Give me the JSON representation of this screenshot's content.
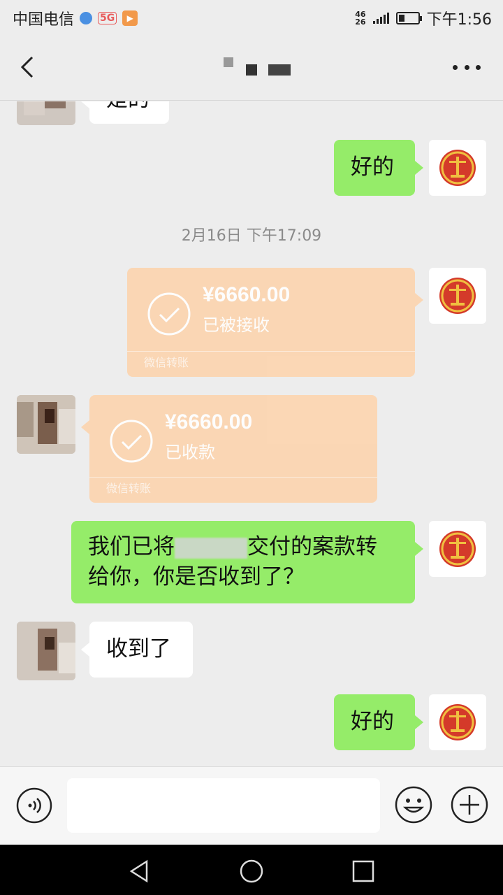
{
  "status_bar": {
    "carrier": "中国电信",
    "network_badge": "5G",
    "signal_text_top": "46",
    "signal_text_bottom": "26",
    "time": "下午1:56",
    "icons": [
      "signal-icon",
      "battery-icon",
      "video-app-icon",
      "hd-icon"
    ]
  },
  "header": {
    "back_icon": "chevron-left-icon",
    "title": "",
    "more_icon": "more-dots-icon"
  },
  "messages": {
    "m1_partial_text": "是的",
    "m2_text": "好的",
    "timestamp": "2月16日 下午17:09",
    "transfer_sent": {
      "amount": "¥6660.00",
      "status": "已被接收",
      "footer": "微信转账"
    },
    "transfer_received": {
      "amount": "¥6660.00",
      "status": "已收款",
      "footer": "微信转账"
    },
    "m5_text_before": "我们已将",
    "m5_text_after": "交付的案款转",
    "m5_text_line2": "给你，你是否收到了？",
    "m6_text": "收到了",
    "m7_text": "好的"
  },
  "input_bar": {
    "value": "",
    "voice_icon": "voice-icon",
    "emoji_icon": "emoji-icon",
    "plus_icon": "plus-icon"
  },
  "nav_bar": {
    "icons": [
      "nav-back-icon",
      "nav-home-icon",
      "nav-recent-icon"
    ]
  },
  "colors": {
    "bubble_green": "#95ec69",
    "bubble_white": "#ffffff",
    "transfer_orange": "#fcd5b0",
    "background": "#ededed"
  }
}
